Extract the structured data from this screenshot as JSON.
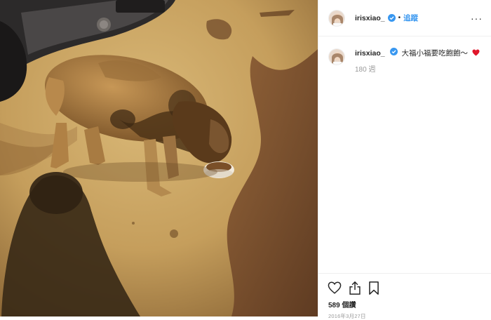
{
  "post": {
    "username": "irisxiao_",
    "separator": "•",
    "follow_label": "追蹤",
    "more_label": "···",
    "caption": {
      "username": "irisxiao_",
      "text": "大福小福要吃飽飽～"
    },
    "age": "180 週",
    "views": "589 個讚",
    "date": "2016年3月27日"
  },
  "colors": {
    "accent": "#3897f0",
    "heart": "#e0162b",
    "verified": "#3897f0"
  },
  "icons": {
    "verified": "verified-badge-icon",
    "like": "heart-outline-icon",
    "share": "share-icon",
    "save": "bookmark-icon",
    "caption_emoji": "red-heart-icon"
  }
}
